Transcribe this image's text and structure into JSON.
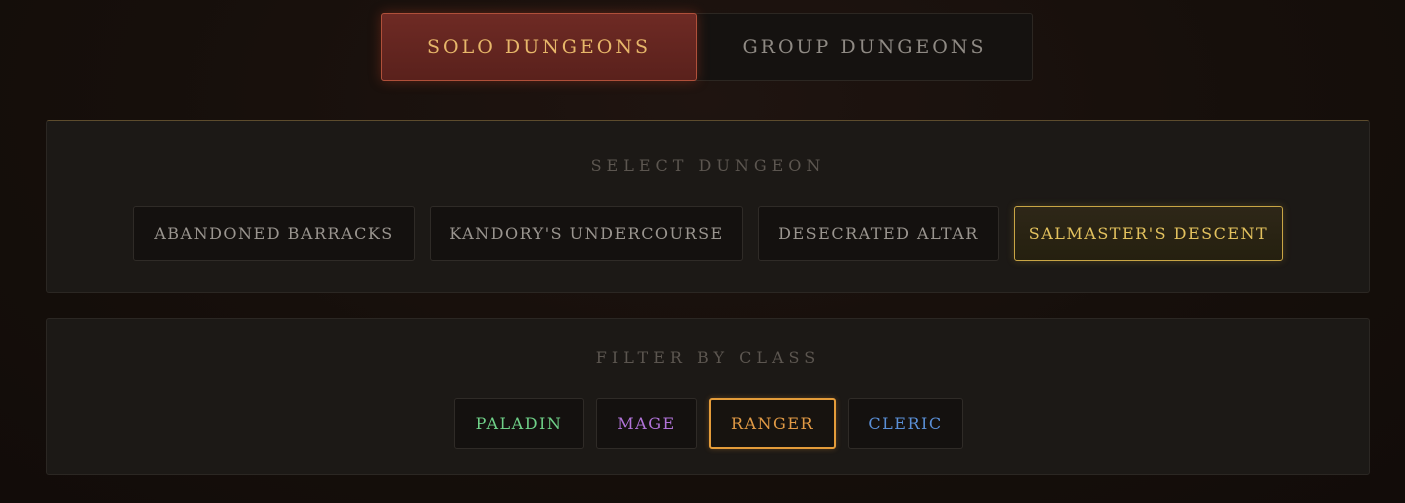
{
  "mode_tabs": [
    {
      "label": "SOLO DUNGEONS",
      "active": true
    },
    {
      "label": "GROUP DUNGEONS",
      "active": false
    }
  ],
  "dungeon_panel": {
    "title": "SELECT DUNGEON",
    "dungeons": [
      {
        "label": "ABANDONED BARRACKS",
        "selected": false
      },
      {
        "label": "KANDORY'S UNDERCOURSE",
        "selected": false
      },
      {
        "label": "DESECRATED ALTAR",
        "selected": false
      },
      {
        "label": "SALMASTER'S DESCENT",
        "selected": true
      }
    ]
  },
  "class_panel": {
    "title": "FILTER BY CLASS",
    "classes": [
      {
        "label": "PALADIN",
        "color": "#6fd088",
        "selected": false
      },
      {
        "label": "MAGE",
        "color": "#b173d8",
        "selected": false
      },
      {
        "label": "RANGER",
        "color": "#e19a45",
        "selected": true
      },
      {
        "label": "CLERIC",
        "color": "#5a8fd6",
        "selected": false
      }
    ]
  },
  "colors": {
    "active_tab_bg": "#6e2a24",
    "active_tab_text": "#e7b76a",
    "selected_dungeon_border": "#c9a545",
    "selected_class_border": "#e49c3a"
  }
}
